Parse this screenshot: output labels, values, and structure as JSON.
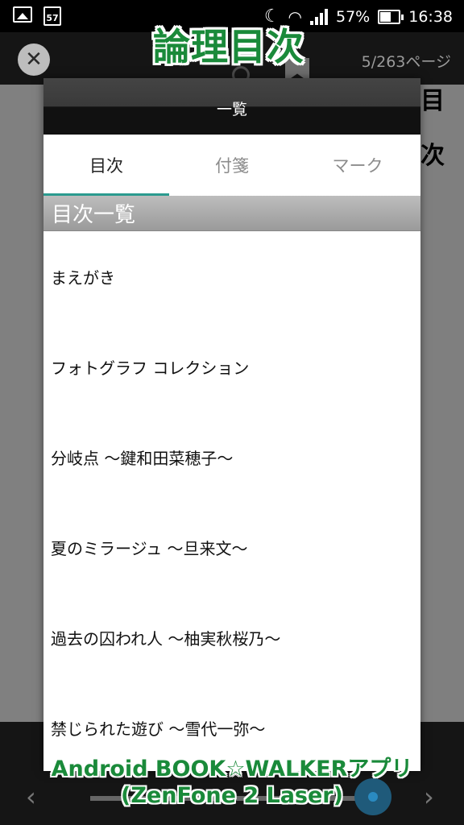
{
  "status_bar": {
    "calendar_day": "57",
    "battery": "57%",
    "time": "16:38"
  },
  "app_bar": {
    "close_icon": "close-icon",
    "page_indicator": "5/263ページ"
  },
  "background_page": {
    "chars": [
      "目",
      "次"
    ]
  },
  "overlay": {
    "title": "論理目次",
    "caption_line1": "Android BOOK☆WALKERアプリ",
    "caption_line2": "(ZenFone 2 Laser)"
  },
  "dialog": {
    "title": "一覧",
    "tabs": [
      {
        "label": "目次",
        "active": true
      },
      {
        "label": "付箋",
        "active": false
      },
      {
        "label": "マーク",
        "active": false
      }
    ],
    "section_header": "目次一覧",
    "toc_items": [
      "まえがき",
      "フォトグラフ コレクション",
      "分岐点 〜鍵和田菜穂子〜",
      "夏のミラージュ 〜旦来文〜",
      "過去の囚われ人 〜柚実秋桜乃〜",
      "禁じられた遊び 〜雪代一弥〜"
    ]
  },
  "colors": {
    "accent": "#2b9b8f",
    "overlay_green": "#1a8a3a"
  }
}
